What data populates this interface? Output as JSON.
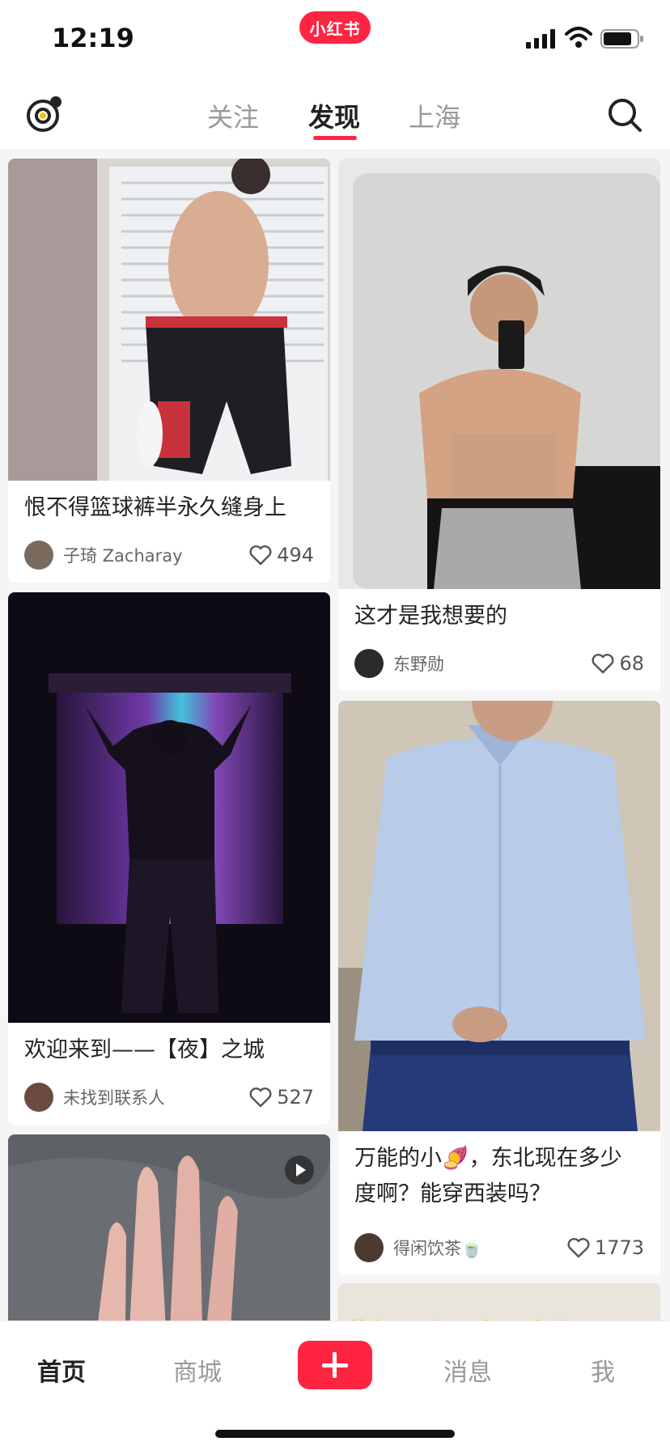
{
  "status_bar": {
    "time": "12:19",
    "app_logo": "小红书"
  },
  "top_nav": {
    "tabs": [
      {
        "label": "关注",
        "active": false
      },
      {
        "label": "发现",
        "active": true
      },
      {
        "label": "上海",
        "active": false
      }
    ]
  },
  "feed": {
    "cards": [
      {
        "title": "恨不得篮球裤半永久缝身上",
        "author": "子琦 Zacharay",
        "likes": "494",
        "image": "shirtless-mirror-selfie-basketball-shorts"
      },
      {
        "title": "这才是我想要的",
        "author": "东野勋",
        "likes": "68",
        "image": "shirtless-mirror-selfie-grey-joggers"
      },
      {
        "title": "欢迎来到——【夜】之城",
        "author": "未找到联系人",
        "likes": "527",
        "image": "silhouette-neon-window"
      },
      {
        "title": "万能的小🍠，东北现在多少度啊？能穿西装吗？",
        "title_line1": "万能的小🍠，东北现在多少",
        "title_line2": "度啊？能穿西装吗？",
        "author": "得闲饮茶🍵",
        "likes": "1773",
        "image": "man-in-light-blue-shirt"
      },
      {
        "video": true,
        "image": "hand-on-grey-sheet"
      },
      {
        "banner_text": "黄气吸尘器多不虚传！",
        "image": "product-banner"
      }
    ]
  },
  "bottom_nav": {
    "items": [
      {
        "label": "首页",
        "active": true
      },
      {
        "label": "商城",
        "active": false
      },
      {
        "label": "消息",
        "active": false
      },
      {
        "label": "我",
        "active": false
      }
    ]
  },
  "colors": {
    "accent": "#ff2442",
    "bg": "#f5f5f5"
  }
}
